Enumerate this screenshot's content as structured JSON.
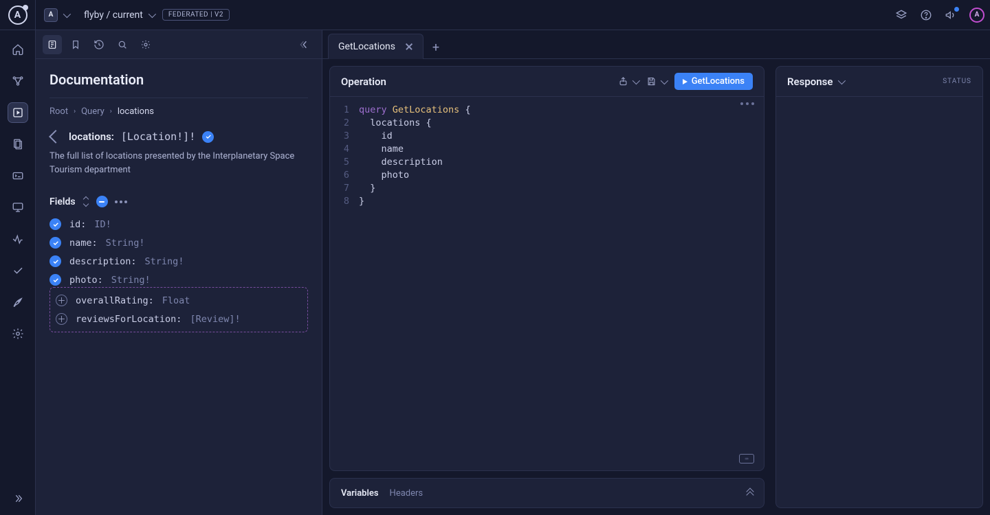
{
  "logo_letter": "A",
  "org_letter": "A",
  "project": "flyby / current",
  "badge": "FEDERATED | V2",
  "avatar_letter": "A",
  "doc": {
    "title": "Documentation",
    "crumbs": {
      "root": "Root",
      "query": "Query",
      "current": "locations"
    },
    "type_name": "locations:",
    "type_sig": "[Location!]!",
    "description": "The full list of locations presented by the Interplanetary Space Tourism department",
    "fields_label": "Fields",
    "fields_selected": [
      {
        "name": "id:",
        "type": "ID!"
      },
      {
        "name": "name:",
        "type": "String!"
      },
      {
        "name": "description:",
        "type": "String!"
      },
      {
        "name": "photo:",
        "type": "String!"
      }
    ],
    "fields_unselected": [
      {
        "name": "overallRating:",
        "type": "Float"
      },
      {
        "name": "reviewsForLocation:",
        "type": "[Review]!"
      }
    ]
  },
  "tab": {
    "label": "GetLocations"
  },
  "operation": {
    "title": "Operation",
    "run_label": "GetLocations",
    "lines": [
      {
        "n": "1",
        "html": "<span class='kw'>query</span> <span class='fn'>GetLocations</span> {"
      },
      {
        "n": "2",
        "html": "  locations {"
      },
      {
        "n": "3",
        "html": "    id"
      },
      {
        "n": "4",
        "html": "    name"
      },
      {
        "n": "5",
        "html": "    description"
      },
      {
        "n": "6",
        "html": "    photo"
      },
      {
        "n": "7",
        "html": "  }"
      },
      {
        "n": "8",
        "html": "}"
      }
    ]
  },
  "vars": {
    "t1": "Variables",
    "t2": "Headers"
  },
  "response": {
    "title": "Response",
    "status": "STATUS"
  }
}
